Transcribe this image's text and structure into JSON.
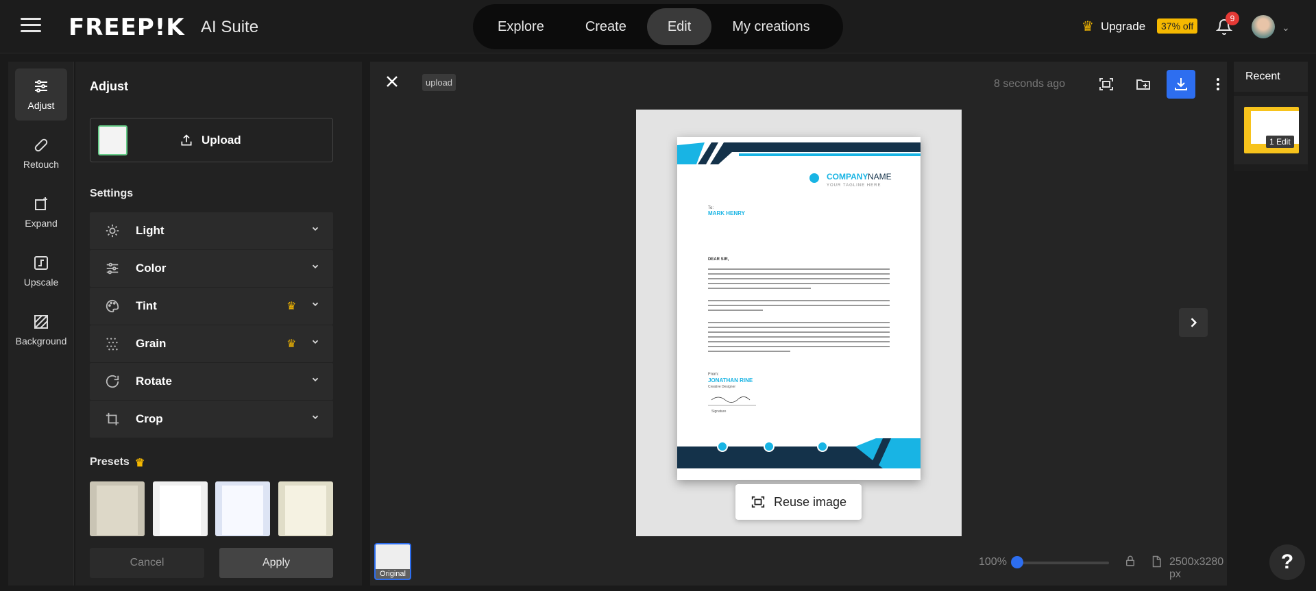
{
  "brand": {
    "logo": "FREEP!K",
    "suite": "AI Suite"
  },
  "nav": [
    {
      "label": "Explore"
    },
    {
      "label": "Create"
    },
    {
      "label": "Edit"
    },
    {
      "label": "My creations"
    }
  ],
  "header": {
    "upgrade_label": "Upgrade",
    "discount": "37% off",
    "notification_count": "9"
  },
  "tools": [
    {
      "label": "Adjust",
      "icon": "sliders-icon"
    },
    {
      "label": "Retouch",
      "icon": "bandage-icon"
    },
    {
      "label": "Expand",
      "icon": "expand-icon"
    },
    {
      "label": "Upscale",
      "icon": "upscale-icon"
    },
    {
      "label": "Background",
      "icon": "background-icon"
    }
  ],
  "panel": {
    "title": "Adjust",
    "upload_label": "Upload",
    "settings_title": "Settings",
    "settings": [
      {
        "label": "Light",
        "icon": "sun-icon",
        "premium": false
      },
      {
        "label": "Color",
        "icon": "sliders-icon",
        "premium": false
      },
      {
        "label": "Tint",
        "icon": "palette-icon",
        "premium": true
      },
      {
        "label": "Grain",
        "icon": "grain-icon",
        "premium": true
      },
      {
        "label": "Rotate",
        "icon": "rotate-icon",
        "premium": false
      },
      {
        "label": "Crop",
        "icon": "crop-icon",
        "premium": false
      }
    ],
    "presets_title": "Presets",
    "cancel_label": "Cancel",
    "apply_label": "Apply"
  },
  "canvas": {
    "tag": "upload",
    "timestamp": "8 seconds ago",
    "reuse_label": "Reuse image",
    "original_label": "Original",
    "zoom": "100%",
    "dimensions": "2500x3280 px",
    "zoom_level": 0.0
  },
  "document": {
    "company": "COMPANY",
    "company_name": "NAME",
    "tagline": "YOUR TAGLINE HERE",
    "to_label": "To:",
    "recipient": "MARK HENRY",
    "greeting": "DEAR SIR,",
    "from_label": "From:",
    "sender": "JONATHAN RINE",
    "sender_role": "Creative Designer",
    "signature_label": "Signature"
  },
  "recent": {
    "title": "Recent",
    "edit_count": "1 Edit"
  },
  "colors": {
    "accent": "#2d6ef0",
    "premium": "#f5b800",
    "doc_navy": "#14324a",
    "doc_cyan": "#18b4e4"
  }
}
